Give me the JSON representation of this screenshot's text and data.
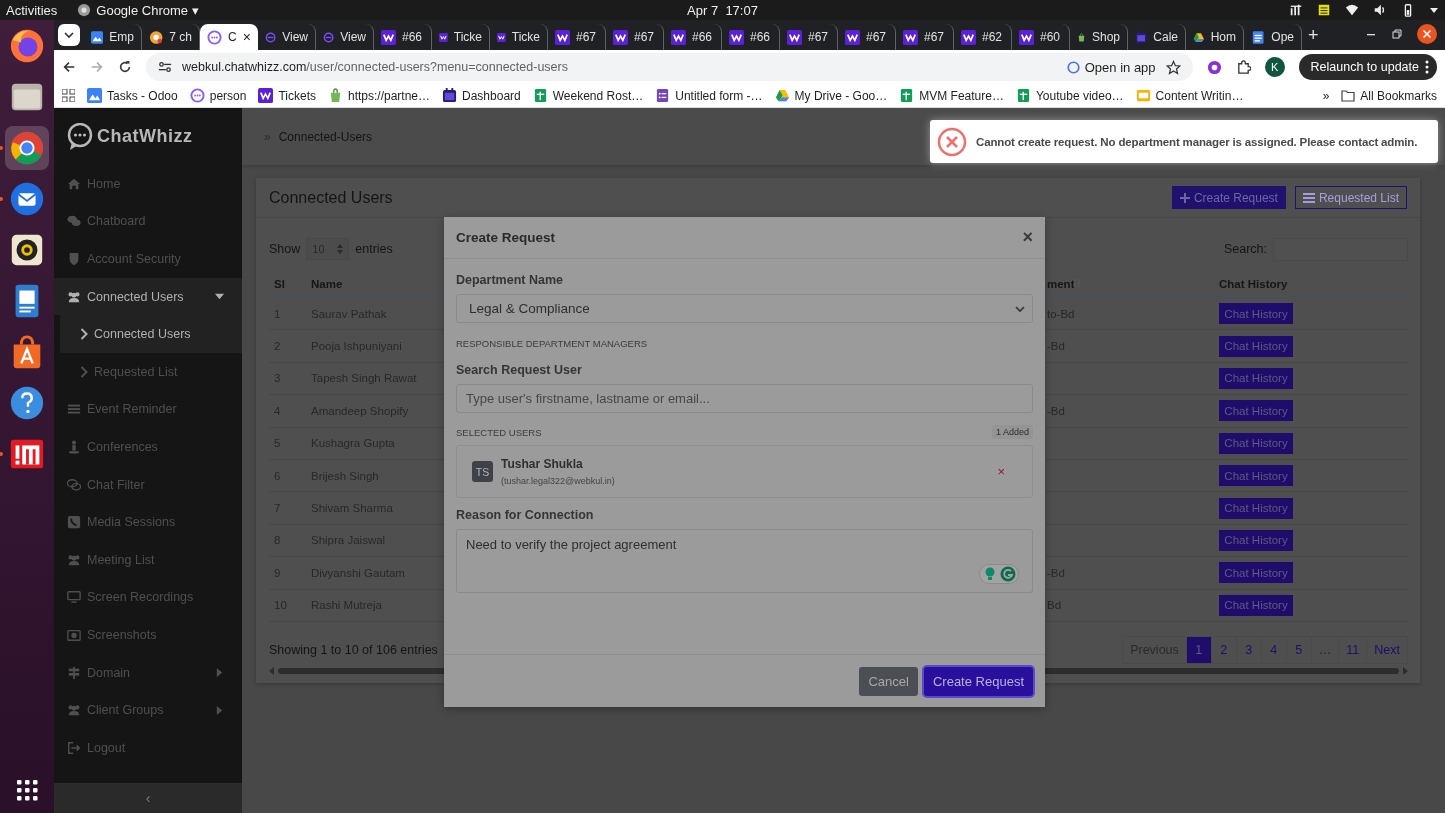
{
  "os_bar": {
    "activities": "Activities",
    "app_name": "Google Chrome",
    "app_menu_arrow": "▾",
    "clock": "Apr 7  17:07"
  },
  "dock": [
    {
      "kind": "firefox",
      "running": false,
      "selected": false
    },
    {
      "kind": "files",
      "running": false,
      "selected": false
    },
    {
      "kind": "chrome",
      "running": true,
      "selected": true
    },
    {
      "kind": "thunderbird",
      "running": true,
      "selected": false
    },
    {
      "kind": "rhythmbox",
      "running": false,
      "selected": false
    },
    {
      "kind": "writer",
      "running": false,
      "selected": false
    },
    {
      "kind": "appcenter",
      "running": false,
      "selected": false
    },
    {
      "kind": "help",
      "running": false,
      "selected": false
    },
    {
      "kind": "redapp",
      "running": true,
      "selected": false
    }
  ],
  "browser": {
    "tabs": [
      {
        "title": "Emp",
        "kind": "odoo",
        "selected": false
      },
      {
        "title": "7 ch",
        "kind": "chatgpt",
        "selected": false
      },
      {
        "title": "C",
        "kind": "chatwhizz",
        "selected": true
      },
      {
        "title": "View",
        "kind": "view",
        "selected": false
      },
      {
        "title": "View",
        "kind": "view",
        "selected": false
      },
      {
        "title": "#66",
        "kind": "w",
        "selected": false
      },
      {
        "title": "Ticke",
        "kind": "w",
        "selected": false
      },
      {
        "title": "Ticke",
        "kind": "w",
        "selected": false
      },
      {
        "title": "#67",
        "kind": "w",
        "selected": false
      },
      {
        "title": "#67",
        "kind": "w",
        "selected": false
      },
      {
        "title": "#66",
        "kind": "w",
        "selected": false
      },
      {
        "title": "#66",
        "kind": "w",
        "selected": false
      },
      {
        "title": "#67",
        "kind": "w",
        "selected": false
      },
      {
        "title": "#67",
        "kind": "w",
        "selected": false
      },
      {
        "title": "#67",
        "kind": "w",
        "selected": false
      },
      {
        "title": "#62",
        "kind": "w",
        "selected": false
      },
      {
        "title": "#60",
        "kind": "w",
        "selected": false
      },
      {
        "title": "Shop",
        "kind": "shopify",
        "selected": false
      },
      {
        "title": "Cale",
        "kind": "calendar",
        "selected": false
      },
      {
        "title": "Hom",
        "kind": "drive",
        "selected": false
      },
      {
        "title": "Ope",
        "kind": "docs",
        "selected": false
      }
    ],
    "close_tab": "×",
    "new_tab": "+",
    "address": "**webkul.chatwhizz.com**/user/connected-users?menu=connected-users",
    "open_in_app": "Open in app",
    "profile_initial": "K",
    "relaunch": "Relaunch to update",
    "bookmarks": [
      {
        "label": "Tasks - Odoo",
        "kind": "odoo"
      },
      {
        "label": "person",
        "kind": "chatwhizz"
      },
      {
        "label": "Tickets",
        "kind": "w"
      },
      {
        "label": "https://partne…",
        "kind": "shopify"
      },
      {
        "label": "Dashboard",
        "kind": "calendar"
      },
      {
        "label": "Weekend Rost…",
        "kind": "sheets"
      },
      {
        "label": "Untitled form -…",
        "kind": "forms"
      },
      {
        "label": "My Drive - Goo…",
        "kind": "drive"
      },
      {
        "label": "MVM Feature…",
        "kind": "sheets"
      },
      {
        "label": "Youtube video…",
        "kind": "sheets"
      },
      {
        "label": "Content Writin…",
        "kind": "slides"
      }
    ],
    "more_bookmarks": "»",
    "all_bookmarks": "All Bookmarks"
  },
  "sidebar": {
    "brand": "ChatWhizz",
    "items": [
      {
        "label": "Home",
        "selected": false
      },
      {
        "label": "Chatboard",
        "selected": false
      },
      {
        "label": "Account Security",
        "selected": false
      },
      {
        "label": "Connected Users",
        "selected": true,
        "expanded": true,
        "children": [
          {
            "label": "Connected Users",
            "selected": true
          },
          {
            "label": "Requested List",
            "selected": false
          }
        ]
      },
      {
        "label": "Event Reminder",
        "selected": false
      },
      {
        "label": "Conferences",
        "selected": false
      },
      {
        "label": "Chat Filter",
        "selected": false
      },
      {
        "label": "Media Sessions",
        "selected": false
      },
      {
        "label": "Meeting List",
        "selected": false
      },
      {
        "label": "Screen Recordings",
        "selected": false
      },
      {
        "label": "Screenshots",
        "selected": false
      },
      {
        "label": "Domain",
        "selected": false,
        "expanded": false
      },
      {
        "label": "Client Groups",
        "selected": false,
        "expanded": false
      },
      {
        "label": "Logout",
        "selected": false
      }
    ],
    "collapse": "‹"
  },
  "page": {
    "breadcrumb_separator": "»",
    "breadcrumb": "Connected-Users",
    "title": "Connected Users",
    "create_button": "Create Request",
    "requested_button": "Requested List",
    "show_label": "Show",
    "page_size": "10",
    "entries_label": "entries",
    "search_label": "Search:",
    "table": {
      "columns": [
        "Sl",
        "Name",
        "ment",
        "Chat History"
      ],
      "rows": [
        {
          "sl": "1",
          "name": "Saurav Pathak",
          "column_3": "to-Bd",
          "action": "Chat History"
        },
        {
          "sl": "2",
          "name": "Pooja Ishpuniyani",
          "column_3": "-Bd",
          "action": "Chat History"
        },
        {
          "sl": "3",
          "name": "Tapesh Singh Rawat",
          "action": "Chat History"
        },
        {
          "sl": "4",
          "name": "Amandeep Shopify",
          "column_3": "-Bd",
          "action": "Chat History"
        },
        {
          "sl": "5",
          "name": "Kushagra Gupta",
          "action": "Chat History"
        },
        {
          "sl": "6",
          "name": "Brijesh Singh",
          "action": "Chat History"
        },
        {
          "sl": "7",
          "name": "Shivam Sharma",
          "action": "Chat History"
        },
        {
          "sl": "8",
          "name": "Shipra Jaiswal",
          "action": "Chat History"
        },
        {
          "sl": "9",
          "name": "Divyanshi Gautam",
          "column_3": "-Bd",
          "action": "Chat History"
        },
        {
          "sl": "10",
          "name": "Rashi Mutreja",
          "column_3": "Bd",
          "action": "Chat History"
        }
      ]
    },
    "info": "Showing 1 to 10 of 106 entries",
    "pagination": [
      {
        "label": "Previous",
        "selected": false
      },
      {
        "label": "1",
        "selected": true
      },
      {
        "label": "2",
        "selected": false
      },
      {
        "label": "3",
        "selected": false
      },
      {
        "label": "4",
        "selected": false
      },
      {
        "label": "5",
        "selected": false
      },
      {
        "label": "…",
        "selected": false
      },
      {
        "label": "11",
        "selected": false
      },
      {
        "label": "Next",
        "selected": false
      }
    ]
  },
  "modal": {
    "title": "Create Request",
    "close": "×",
    "department_label": "Department Name",
    "department_value": "Legal & Compliance",
    "managers_heading": "RESPONSIBLE DEPARTMENT MANAGERS",
    "search_label": "Search Request User",
    "search_placeholder": "Type user's firstname, lastname or email...",
    "selected_heading": "SELECTED USERS",
    "added_count": "1 Added",
    "selected_users": [
      {
        "initials": "TS",
        "name": "Tushar Shukla",
        "email": "(tushar.legal322@webkul.in)",
        "remove": "×"
      }
    ],
    "reason_label": "Reason for Connection",
    "reason_value": "Need to verify the project agreement",
    "buttons": [
      {
        "label": "Cancel",
        "kind": "secondary"
      },
      {
        "label": "Create Request",
        "kind": "primary"
      }
    ]
  },
  "toast": {
    "kind": "error",
    "message": "Cannot create request. No department manager is assigned. Please contact admin."
  }
}
